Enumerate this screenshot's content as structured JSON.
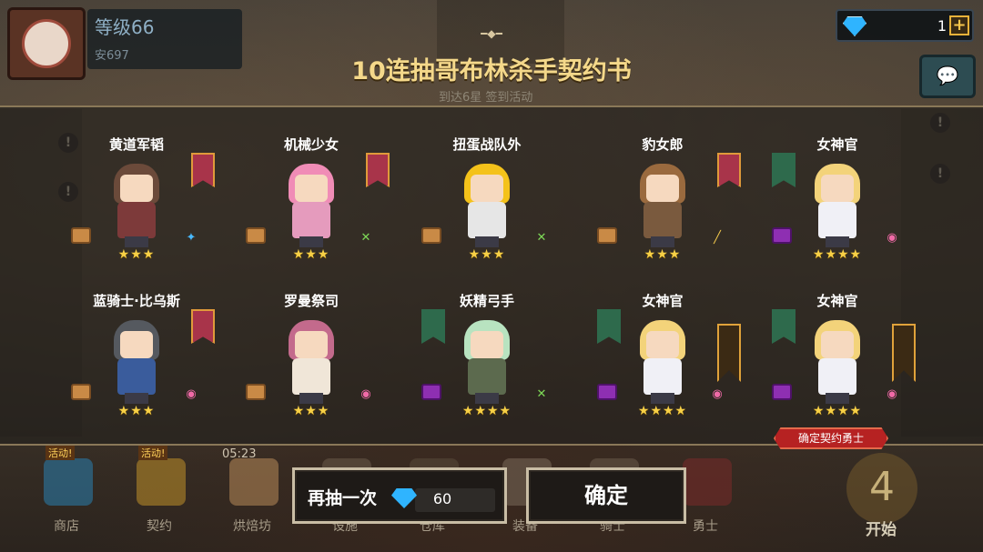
{
  "header": {
    "level": "等级66",
    "level_sub": "安697",
    "gems": "1",
    "plus": "+",
    "chat_icon": "chat-icon"
  },
  "title": "10连抽哥布林杀手契约书",
  "subtitle": "到达6星 签到活动",
  "cards": [
    {
      "name": "黄道军韬",
      "stars": "★★★",
      "banner": "red",
      "item": "scroll",
      "hair": "#6b4a3a",
      "body": "#7d3a3a",
      "gear": "✦",
      "gear_color": "#48b9ff"
    },
    {
      "name": "机械少女",
      "stars": "★★★",
      "banner": "red",
      "item": "scroll",
      "hair": "#f08cb6",
      "body": "#e59bbd",
      "gear": "✕",
      "gear_color": "#7ed957"
    },
    {
      "name": "扭蛋战队外",
      "stars": "★★★",
      "banner": "none",
      "item": "scroll",
      "hair": "#f4c21a",
      "body": "#e6e6e6",
      "gear": "✕",
      "gear_color": "#7ed957"
    },
    {
      "name": "豹女郎",
      "stars": "★★★",
      "banner": "red",
      "item": "scroll",
      "hair": "#9a6a3e",
      "body": "#7a5a3e",
      "gear": "╱",
      "gear_color": "#f2c94c"
    },
    {
      "name": "女神官",
      "stars": "★★★★",
      "banner": "green",
      "item": "purple",
      "hair": "#f3d37a",
      "body": "#f0f0f6",
      "gear": "◉",
      "gear_color": "#f06aa7"
    },
    {
      "name": "蓝骑士·比乌斯",
      "stars": "★★★",
      "banner": "red",
      "item": "scroll",
      "hair": "#55595f",
      "body": "#3a5c9c",
      "gear": "◉",
      "gear_color": "#f06aa7"
    },
    {
      "name": "罗曼祭司",
      "stars": "★★★",
      "banner": "none",
      "item": "scroll",
      "hair": "#c36a8c",
      "body": "#f0e6d8",
      "gear": "◉",
      "gear_color": "#f06aa7"
    },
    {
      "name": "妖精弓手",
      "stars": "★★★★",
      "banner": "green",
      "item": "purple",
      "hair": "#b8e3c0",
      "body": "#5c6a4e",
      "gear": "✕",
      "gear_color": "#7ed957"
    },
    {
      "name": "女神官",
      "stars": "★★★★",
      "banner": "green-orange",
      "item": "purple",
      "hair": "#f3d37a",
      "body": "#f0f0f6",
      "gear": "◉",
      "gear_color": "#f06aa7"
    },
    {
      "name": "女神官",
      "stars": "★★★★",
      "banner": "green-orange",
      "item": "purple",
      "hair": "#f3d37a",
      "body": "#f0f0f6",
      "gear": "◉",
      "gear_color": "#f06aa7"
    }
  ],
  "confirm_tag": "确定契约勇士",
  "retry": {
    "label": "再抽一次",
    "cost": "60"
  },
  "ok_label": "确定",
  "timer": "05:23",
  "nav": [
    {
      "label": "商店",
      "badge": "活动!",
      "color": "#2a7fb0"
    },
    {
      "label": "契约",
      "badge": "活动!",
      "color": "#c0902a"
    },
    {
      "label": "烘焙坊",
      "badge": "",
      "color": "#b88a5a"
    },
    {
      "label": "设施",
      "badge": "",
      "color": "#6a5a4a"
    },
    {
      "label": "仓库",
      "badge": "",
      "color": "#5a4a3a"
    },
    {
      "label": "装备",
      "badge": "",
      "color": "#7a6a5a"
    },
    {
      "label": "骑士",
      "badge": "",
      "color": "#6a5a4a"
    },
    {
      "label": "勇士",
      "badge": "",
      "color": "#7a2a2a"
    }
  ],
  "start_label": "开始",
  "start_num": "4"
}
